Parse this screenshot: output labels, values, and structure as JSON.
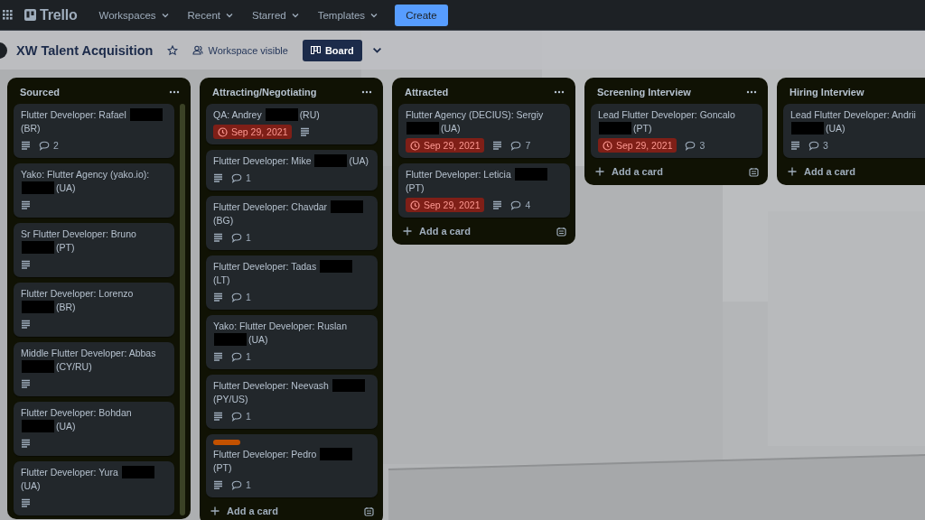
{
  "topbar": {
    "logo": "Trello",
    "nav": [
      {
        "label": "Workspaces"
      },
      {
        "label": "Recent"
      },
      {
        "label": "Starred"
      },
      {
        "label": "Templates"
      }
    ],
    "create": "Create"
  },
  "board": {
    "title": "XW Talent Acquisition",
    "visibility": "Workspace visible",
    "view": "Board"
  },
  "lists": [
    {
      "title": "Sourced",
      "menu": true,
      "scrollbar": true,
      "cards": [
        {
          "title": "Flutter Developer: Rafael",
          "redacted": true,
          "suffix": "(BR)",
          "description": true,
          "comments": "2"
        },
        {
          "title": "Yako: Flutter Agency (yako.io):",
          "redacted": true,
          "suffix": "(UA)",
          "description": true
        },
        {
          "title": "Sr Flutter Developer: Bruno",
          "redacted": true,
          "suffix": "(PT)",
          "description": true
        },
        {
          "title": "Flutter Developer: Lorenzo",
          "redacted": true,
          "suffix": "(BR)",
          "description": true
        },
        {
          "title": "Middle Flutter Developer: Abbas",
          "redacted": true,
          "suffix": "(CY/RU)",
          "description": true
        },
        {
          "title": "Flutter Developer: Bohdan",
          "redacted": true,
          "suffix": "(UA)",
          "description": true
        },
        {
          "title": "Flutter Developer: Yura",
          "redacted": true,
          "suffix": "(UA)",
          "description": true
        }
      ]
    },
    {
      "title": "Attracting/Negotiating",
      "menu": true,
      "scrollbar": false,
      "add_card": "Add a card",
      "template_button": true,
      "cards": [
        {
          "title": "QA: Andrey",
          "redacted": true,
          "suffix": "(RU)",
          "due": "Sep 29, 2021",
          "description": true
        },
        {
          "title": "Flutter Developer: Mike",
          "redacted": true,
          "suffix": "(UA)",
          "description": true,
          "comments": "1"
        },
        {
          "title": "Flutter Developer: Chavdar",
          "redacted": true,
          "suffix": "(BG)",
          "description": true,
          "comments": "1"
        },
        {
          "title": "Flutter Developer: Tadas",
          "redacted": true,
          "suffix": "(LT)",
          "description": true,
          "comments": "1"
        },
        {
          "title": "Yako: Flutter Developer: Ruslan",
          "redacted": true,
          "suffix": "(UA)",
          "description": true,
          "comments": "1"
        },
        {
          "title": "Flutter Developer: Neevash",
          "redacted": true,
          "suffix": "(PY/US)",
          "description": true,
          "comments": "1"
        },
        {
          "labels": [
            {
              "color": "#c25100"
            }
          ],
          "title": "Flutter Developer: Pedro",
          "redacted": true,
          "suffix": "(PT)",
          "description": true,
          "comments": "1"
        }
      ]
    },
    {
      "title": "Attracted",
      "menu": true,
      "scrollbar": false,
      "add_card": "Add a card",
      "template_button": true,
      "cards": [
        {
          "title": "Flutter Agency (DECIUS): Sergiy",
          "redacted": true,
          "suffix": "(UA)",
          "due": "Sep 29, 2021",
          "description": true,
          "comments": "7"
        },
        {
          "title": "Flutter Developer: Leticia",
          "redacted": true,
          "suffix": "(PT)",
          "due": "Sep 29, 2021",
          "description": true,
          "comments": "4"
        }
      ]
    },
    {
      "title": "Screening Interview",
      "menu": true,
      "scrollbar": false,
      "add_card": "Add a card",
      "template_button": true,
      "cards": [
        {
          "title": "Lead Flutter Developer: Goncalo",
          "redacted": true,
          "suffix": "(PT)",
          "due": "Sep 29, 2021",
          "description": false,
          "comments": "3"
        }
      ]
    },
    {
      "title": "Hiring Interview",
      "menu": false,
      "scrollbar": false,
      "add_card": "Add a card",
      "template_button": false,
      "cards": [
        {
          "title": "Lead Flutter Developer: Andrii",
          "redacted": true,
          "suffix": "(UA)",
          "description": true,
          "comments": "3"
        }
      ]
    }
  ]
}
